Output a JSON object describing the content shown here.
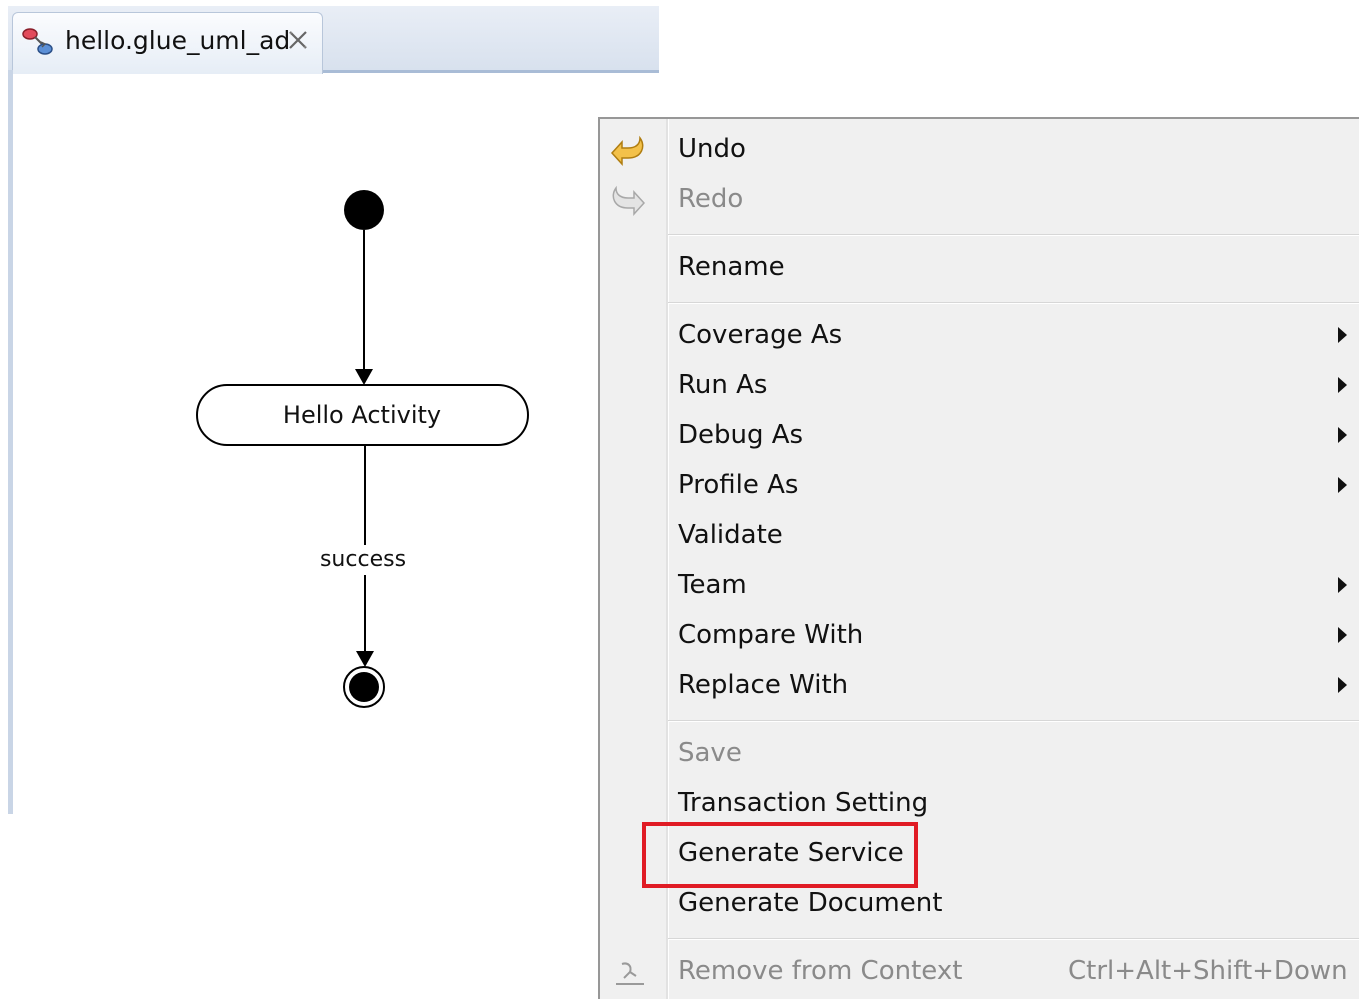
{
  "editor": {
    "tab": {
      "title": "hello.glue_uml_ad",
      "icon": "activity-diagram-icon",
      "close_icon": "close-icon"
    },
    "diagram": {
      "activity_label": "Hello Activity",
      "edge_label": "success"
    }
  },
  "context_menu": {
    "items": [
      {
        "label": "Undo",
        "enabled": true,
        "icon": "undo-icon"
      },
      {
        "label": "Redo",
        "enabled": false,
        "icon": "redo-icon"
      },
      {
        "label": "Rename",
        "enabled": true
      },
      {
        "label": "Coverage As",
        "enabled": true,
        "submenu": true
      },
      {
        "label": "Run As",
        "enabled": true,
        "submenu": true
      },
      {
        "label": "Debug As",
        "enabled": true,
        "submenu": true
      },
      {
        "label": "Profile As",
        "enabled": true,
        "submenu": true
      },
      {
        "label": "Validate",
        "enabled": true
      },
      {
        "label": "Team",
        "enabled": true,
        "submenu": true
      },
      {
        "label": "Compare With",
        "enabled": true,
        "submenu": true
      },
      {
        "label": "Replace With",
        "enabled": true,
        "submenu": true
      },
      {
        "label": "Save",
        "enabled": false
      },
      {
        "label": "Transaction Setting",
        "enabled": true
      },
      {
        "label": "Generate Service",
        "enabled": true,
        "highlighted": true
      },
      {
        "label": "Generate Document",
        "enabled": true
      },
      {
        "label": "Remove from Context",
        "enabled": false,
        "icon": "remove-context-icon",
        "shortcut": "Ctrl+Alt+Shift+Down"
      }
    ]
  },
  "colors": {
    "highlight_border": "#e01b24",
    "menu_background": "#f0f0f0",
    "disabled_text": "#8a8a8a"
  }
}
